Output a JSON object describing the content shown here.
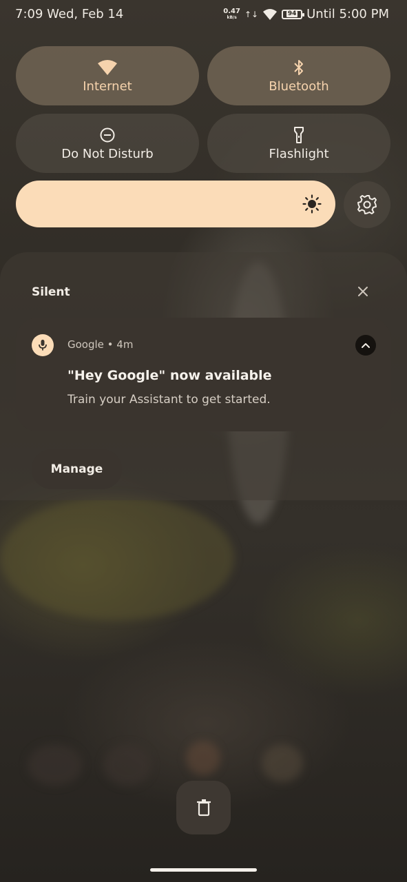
{
  "status_bar": {
    "time_date": "7:09 Wed, Feb 14",
    "net_speed": "0.47",
    "net_unit": "kB/s",
    "battery": "94",
    "until": "Until 5:00 PM",
    "icons": [
      "upload-download-icon",
      "wifi-icon",
      "battery-icon"
    ]
  },
  "quick_settings": {
    "tiles": [
      {
        "label": "Internet",
        "icon": "wifi-icon",
        "active": true
      },
      {
        "label": "Bluetooth",
        "icon": "bluetooth-icon",
        "active": true
      },
      {
        "label": "Do Not Disturb",
        "icon": "do-not-disturb-icon",
        "active": false
      },
      {
        "label": "Flashlight",
        "icon": "flashlight-icon",
        "active": false
      }
    ],
    "brightness_level": 1.0,
    "brightness_icon": "sun-icon",
    "settings_icon": "gear-icon"
  },
  "notifications": {
    "section_title": "Silent",
    "clear_icon": "close-icon",
    "items": [
      {
        "app": "Google",
        "time": "4m",
        "meta": "Google • 4m",
        "title": "\"Hey Google\" now available",
        "text": "Train your Assistant to get started.",
        "icon": "microphone-icon"
      }
    ],
    "manage_label": "Manage"
  },
  "bottom": {
    "clear_all_icon": "trash-icon"
  },
  "colors": {
    "accent": "#fbdcb8",
    "tile_active_label": "#f6d3ad"
  }
}
